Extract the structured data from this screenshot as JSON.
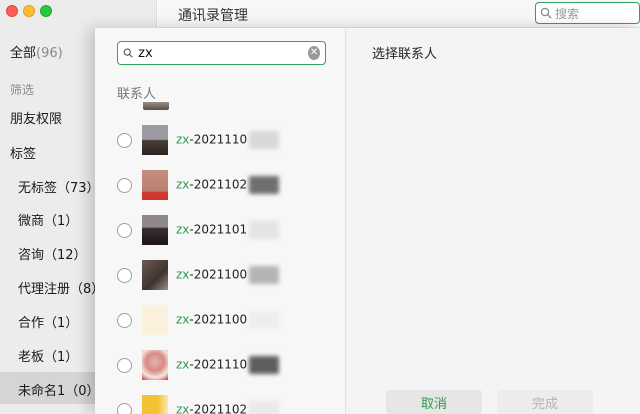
{
  "sidebar": {
    "all_label": "全部",
    "all_count": "(96)",
    "filter_label": "筛选",
    "friend_perm": "朋友权限",
    "tags_label": "标签",
    "tags": [
      {
        "label": "无标签（73）"
      },
      {
        "label": "微商（1）"
      },
      {
        "label": "咨询（12）"
      },
      {
        "label": "代理注册（8）"
      },
      {
        "label": "合作（1）"
      },
      {
        "label": "老板（1）"
      },
      {
        "label": "未命名1（0）"
      }
    ]
  },
  "header": {
    "title": "通讯录管理",
    "search_placeholder": "搜索"
  },
  "dialog": {
    "search_value": "zx",
    "section_title": "联系人",
    "contacts": [
      {
        "match": "zx",
        "rest": "-2021110"
      },
      {
        "match": "zx",
        "rest": "-2021102"
      },
      {
        "match": "zx",
        "rest": "-2021101"
      },
      {
        "match": "zx",
        "rest": "-2021100"
      },
      {
        "match": "zx",
        "rest": "-2021100"
      },
      {
        "match": "zx",
        "rest": "-2021110"
      },
      {
        "match": "zx",
        "rest": "-2021102"
      }
    ],
    "right_title": "选择联系人",
    "cancel_label": "取消",
    "done_label": "完成"
  },
  "colors": {
    "accent_green": "#2fa35a",
    "highlight_text": "#2a9b4e"
  }
}
